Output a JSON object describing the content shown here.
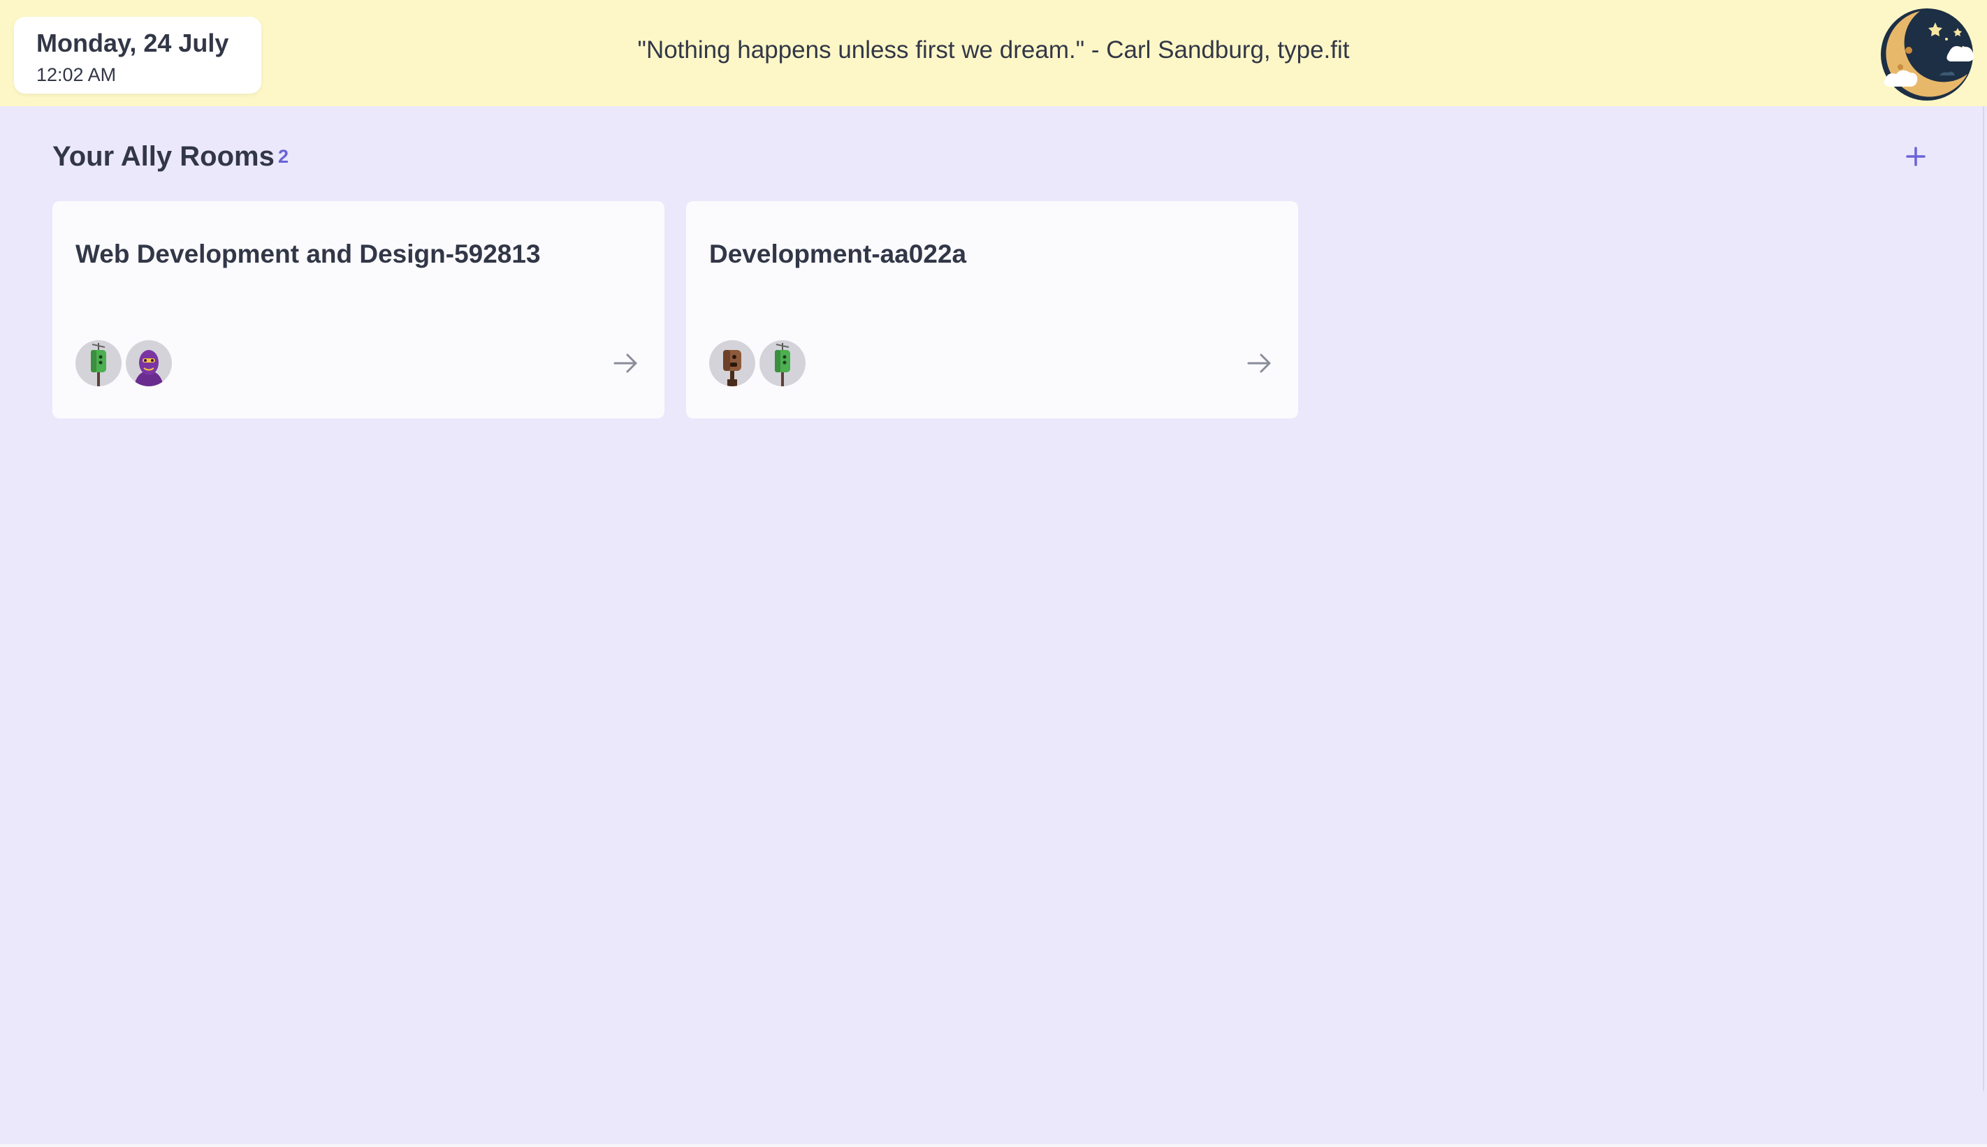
{
  "header": {
    "date": "Monday, 24 July",
    "time": "12:02 AM",
    "quote": "\"Nothing happens unless first we dream.\" - Carl Sandburg, type.fit",
    "mode_icon": "moon-night-icon",
    "background_color": "#fdf7c7"
  },
  "rooms_section": {
    "title": "Your Ally Rooms",
    "count": "2",
    "add_icon": "plus-icon",
    "accent_color": "#6a63d7"
  },
  "rooms": [
    {
      "name": "Web Development and Design-592813",
      "members": [
        "green-robot-avatar",
        "purple-monster-avatar"
      ],
      "open_icon": "arrow-right-icon"
    },
    {
      "name": "Development-aa022a",
      "members": [
        "brown-robot-avatar",
        "green-robot-avatar"
      ],
      "open_icon": "arrow-right-icon"
    }
  ]
}
